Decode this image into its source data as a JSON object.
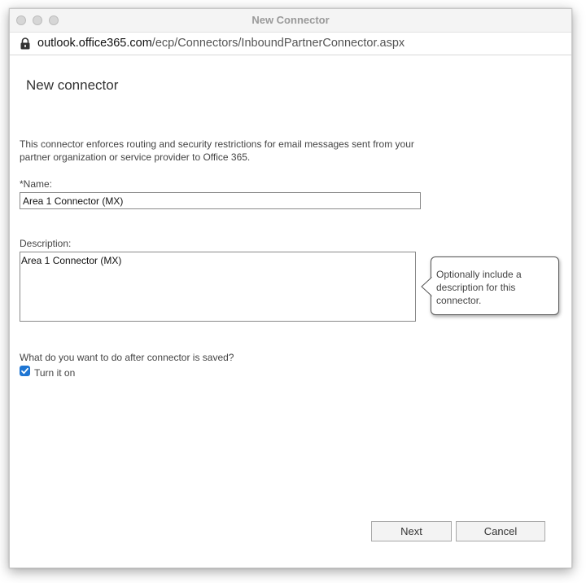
{
  "window": {
    "title": "New Connector"
  },
  "address_bar": {
    "url_host": "outlook.office365.com",
    "url_path": "/ecp/Connectors/InboundPartnerConnector.aspx"
  },
  "page": {
    "title": "New connector",
    "intro_text": "This connector enforces routing and security restrictions for email messages sent from your partner organization or service provider to Office 365."
  },
  "form": {
    "name_label": "*Name:",
    "name_value": "Area 1 Connector (MX)",
    "description_label": "Description:",
    "description_value": "Area 1 Connector (MX)",
    "description_tooltip": "Optionally include a description for this connector.",
    "after_save_question": "What do you want to do after connector is saved?",
    "turn_on_label": "Turn it on",
    "turn_on_checked": true
  },
  "buttons": {
    "next_label": "Next",
    "cancel_label": "Cancel"
  },
  "colors": {
    "checkbox_accent": "#1f76d3"
  }
}
